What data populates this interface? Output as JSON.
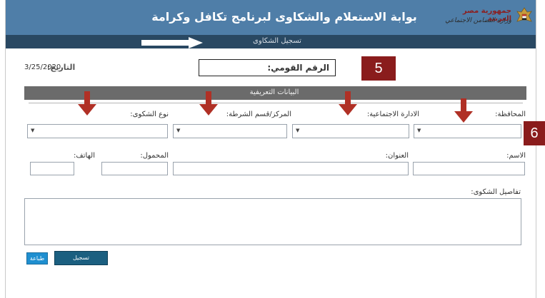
{
  "header": {
    "title": "بوابة الاستعلام والشكاوى لبرنامج تكافل وكرامة",
    "ministry_line1": "جمهورية مصر العربية",
    "ministry_line2": "وزارة التضامن الاجتماعي",
    "background_color": "#4f7ea8"
  },
  "subbar": {
    "label": "تسجيل الشكاوى",
    "background_color": "#294862"
  },
  "date": {
    "label": "التاريخ:",
    "value": "3/25/2020"
  },
  "national_id": {
    "label": "الرقم القومي:"
  },
  "badges": {
    "step5": "5",
    "step6": "6",
    "color": "#8a1c1c"
  },
  "section": {
    "title": "البيانات التعريفية"
  },
  "fields": {
    "governorate": "المحافظة:",
    "social_admin": "الادارة الاجتماعية:",
    "police_station": "المركز/قسم الشرطة:",
    "complaint_type": "نوع الشكوى:",
    "name": "الاسم:",
    "address": "العنوان:",
    "mobile": "المحمول:",
    "phone": "الهاتف:",
    "complaint_details": "تفاصيل الشكوى:"
  },
  "icons": {
    "dropdown_caret": "▼",
    "red_arrow": "arrow-down-icon",
    "white_arrow": "arrow-right-icon"
  },
  "buttons": {
    "submit": "تسجيل",
    "print": "طباعة"
  }
}
